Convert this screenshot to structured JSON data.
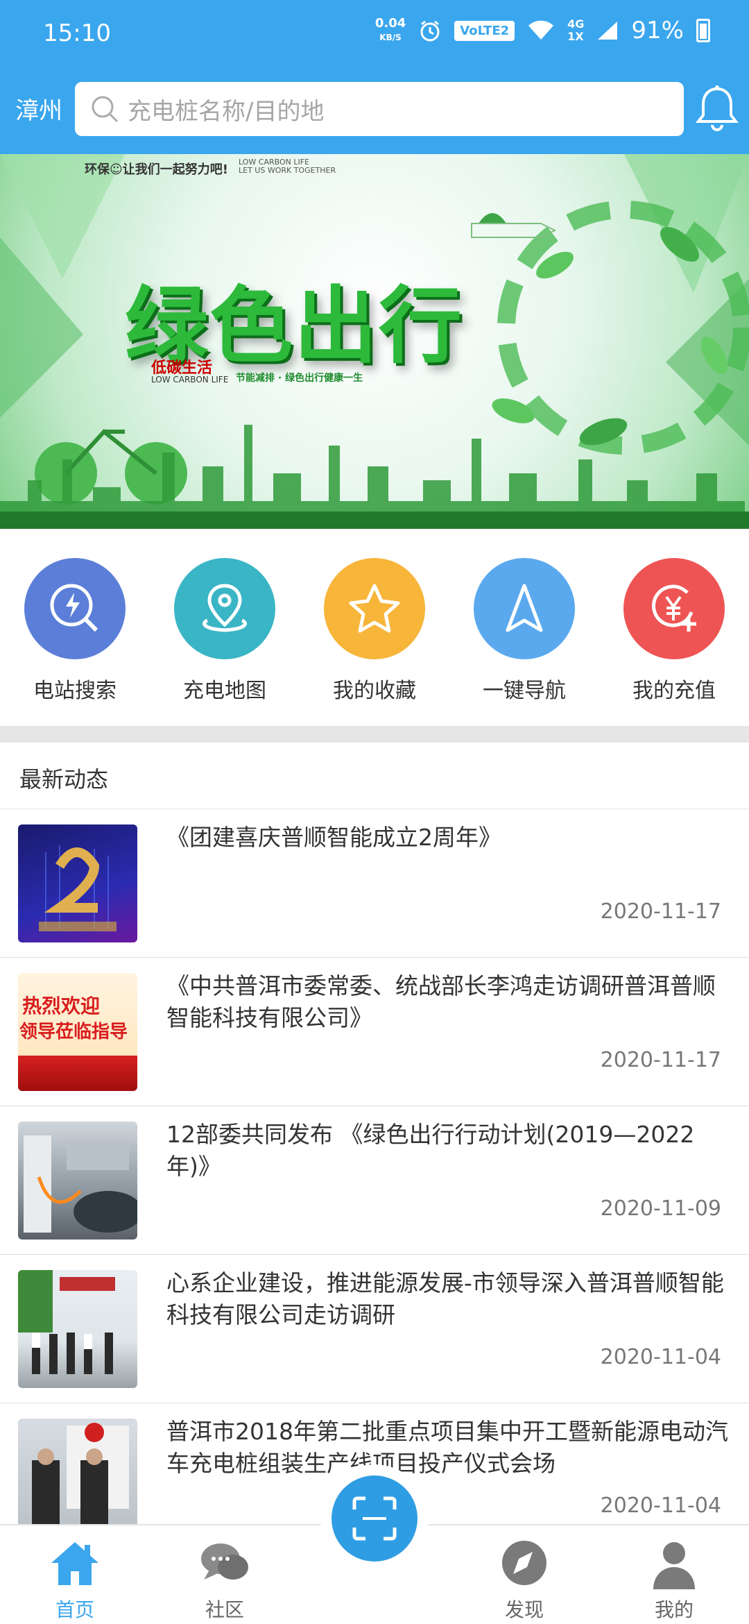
{
  "status_bar": {
    "time": "15:10",
    "speed_value": "0.04",
    "speed_unit": "KB/S",
    "volte": "VoLTE2",
    "network_top": "4G",
    "network_bottom": "1X",
    "battery": "91%"
  },
  "header": {
    "city": "漳州",
    "search_placeholder": "充电桩名称/目的地"
  },
  "banner": {
    "tagline": "环保☺让我们一起努力吧!",
    "tagline_en_1": "LOW CARBON LIFE",
    "tagline_en_2": "LET US WORK TOGETHER",
    "slogan": "绿色出行",
    "sub_cn": "低碳生活",
    "sub_en": "LOW CARBON LIFE",
    "sub_motto": "节能减排 · 绿色出行健康一生"
  },
  "quick_menu": [
    {
      "label": "电站搜索",
      "icon": "station-search-icon",
      "color": "#5b7fd8"
    },
    {
      "label": "充电地图",
      "icon": "map-pin-icon",
      "color": "#3ab5c6"
    },
    {
      "label": "我的收藏",
      "icon": "star-icon",
      "color": "#f7b53a"
    },
    {
      "label": "一键导航",
      "icon": "navigation-icon",
      "color": "#5aa9ee"
    },
    {
      "label": "我的充值",
      "icon": "recharge-icon",
      "color": "#ee5454"
    }
  ],
  "news": {
    "section_title": "最新动态",
    "items": [
      {
        "title": "《团建喜庆普顺智能成立2周年》",
        "date": "2020-11-17"
      },
      {
        "title": "《中共普洱市委常委、统战部长李鸿走访调研普洱普顺智能科技有限公司》",
        "date": "2020-11-17",
        "thumb_text_1": "热烈欢迎",
        "thumb_text_2": "领导莅临指导"
      },
      {
        "title": "12部委共同发布 《绿色出行行动计划(2019—2022年)》",
        "date": "2020-11-09"
      },
      {
        "title": "心系企业建设，推进能源发展-市领导深入普洱普顺智能科技有限公司走访调研",
        "date": "2020-11-04"
      },
      {
        "title": "普洱市2018年第二批重点项目集中开工暨新能源电动汽车充电桩组装生产线项目投产仪式会场",
        "date": "2020-11-04"
      }
    ]
  },
  "tab_bar": [
    {
      "label": "首页",
      "icon": "home-icon",
      "active": true
    },
    {
      "label": "社区",
      "icon": "chat-bubbles-icon",
      "active": false
    },
    {
      "label": "",
      "icon": "scan-icon",
      "active": false
    },
    {
      "label": "发现",
      "icon": "compass-icon",
      "active": false
    },
    {
      "label": "我的",
      "icon": "user-icon",
      "active": false
    }
  ],
  "colors": {
    "primary": "#3aa6ee",
    "scan_button": "#2f9de3",
    "slogan_green": "#2dba3a"
  }
}
